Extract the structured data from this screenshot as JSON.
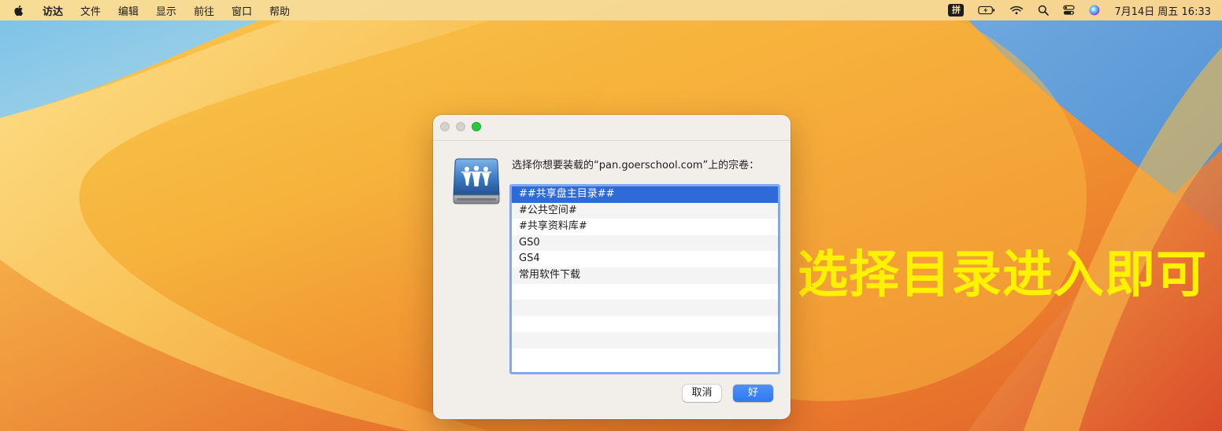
{
  "menubar": {
    "app_name": "访达",
    "items": [
      "文件",
      "编辑",
      "显示",
      "前往",
      "窗口",
      "帮助"
    ],
    "input_method": "拼",
    "clock": "7月14日 周五 16:33"
  },
  "dialog": {
    "prompt": "选择你想要装载的“pan.goerschool.com”上的宗卷：",
    "volumes": [
      "##共享盘主目录##",
      "#公共空间#",
      "#共享资料库#",
      "GS0",
      "GS4",
      "常用软件下载",
      "",
      "",
      "",
      "",
      ""
    ],
    "selected_index": 0,
    "cancel_label": "取消",
    "ok_label": "好"
  },
  "annotation": {
    "text": "选择目录进入即可",
    "color": "#fff200"
  },
  "colors": {
    "accent": "#2f6bd8",
    "list_border": "#83a9ec",
    "ok_button": "#3a83f3"
  }
}
